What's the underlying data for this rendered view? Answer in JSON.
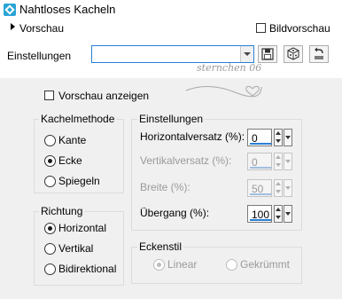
{
  "window": {
    "title": "Nahtloses Kacheln"
  },
  "toolbar": {
    "preview_toggle": "Vorschau",
    "bildvorschau": "Bildvorschau",
    "einstellungen_label": "Einstellungen",
    "preset_value": ""
  },
  "watermark": "sternchen 06",
  "options": {
    "vorschau_anzeigen": "Vorschau anzeigen"
  },
  "kachelmethode": {
    "title": "Kachelmethode",
    "options": [
      "Kante",
      "Ecke",
      "Spiegeln"
    ],
    "selected": "Ecke"
  },
  "richtung": {
    "title": "Richtung",
    "options": [
      "Horizontal",
      "Vertikal",
      "Bidirektional"
    ],
    "selected": "Horizontal"
  },
  "settings": {
    "title": "Einstellungen",
    "horizontal_label": "Horizontalversatz (%):",
    "horizontal_value": "0",
    "vertikal_label": "Vertikalversatz (%):",
    "vertikal_value": "0",
    "breite_label": "Breite (%):",
    "breite_value": "50",
    "uebergang_label": "Übergang (%):",
    "uebergang_value": "100"
  },
  "eckenstil": {
    "title": "Eckenstil",
    "options": [
      "Linear",
      "Gekrümmt"
    ],
    "selected": "Linear"
  },
  "colors": {
    "accent": "#2a7fd4",
    "panel": "#f0f0f0",
    "app_icon": "#2aa4d6"
  }
}
